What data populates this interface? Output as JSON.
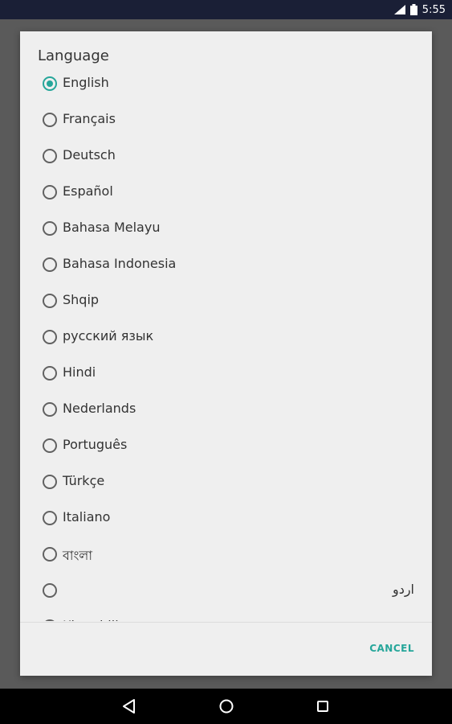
{
  "status_bar": {
    "time": "5:55",
    "icons": [
      "signal-icon",
      "battery-icon"
    ]
  },
  "dialog": {
    "title": "Language",
    "options": [
      {
        "label": "English",
        "checked": true
      },
      {
        "label": "Français",
        "checked": false
      },
      {
        "label": "Deutsch",
        "checked": false
      },
      {
        "label": "Español",
        "checked": false
      },
      {
        "label": "Bahasa Melayu",
        "checked": false
      },
      {
        "label": "Bahasa Indonesia",
        "checked": false
      },
      {
        "label": "Shqip",
        "checked": false
      },
      {
        "label": "русский язык",
        "checked": false
      },
      {
        "label": "Hindi",
        "checked": false
      },
      {
        "label": "Nederlands",
        "checked": false
      },
      {
        "label": "Português",
        "checked": false
      },
      {
        "label": "Türkçe",
        "checked": false
      },
      {
        "label": "Italiano",
        "checked": false
      },
      {
        "label": "বাংলা",
        "checked": false
      },
      {
        "label": "اردو",
        "checked": false,
        "rtl": true
      },
      {
        "label": "Kiswahili",
        "checked": false
      }
    ],
    "cancel_label": "CANCEL"
  },
  "nav_bar": {
    "buttons": [
      "back-icon",
      "home-icon",
      "recents-icon"
    ]
  },
  "colors": {
    "accent": "#26a69a",
    "status_bar": "#1a1f36",
    "scrim": "#5a5a5a",
    "dialog_bg": "#efefef"
  }
}
